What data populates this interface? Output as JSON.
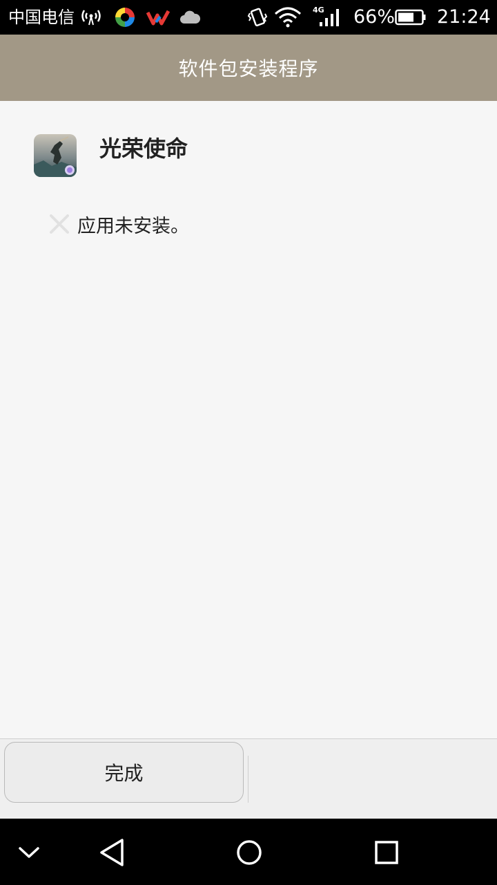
{
  "status_bar": {
    "carrier": "中国电信",
    "battery_percent": "66%",
    "network": "4G",
    "time": "21:24",
    "icons": [
      "hotspot-icon",
      "app-notification-icon",
      "weibo-notification-icon",
      "cloud-icon",
      "vibrate-icon",
      "wifi-icon",
      "signal-icon",
      "battery-icon"
    ]
  },
  "title_bar": {
    "title": "软件包安装程序"
  },
  "app": {
    "name": "光荣使命",
    "icon": "game-app-icon"
  },
  "install_status": {
    "icon": "close-x-icon",
    "text": "应用未安装。"
  },
  "actions": {
    "done_label": "完成"
  },
  "nav_bar": {
    "buttons": [
      "collapse-icon",
      "back-icon",
      "home-icon",
      "recents-icon"
    ]
  },
  "colors": {
    "title_bar_bg": "#a29886",
    "content_bg": "#f6f6f6",
    "bottom_bar_bg": "#efefef"
  }
}
